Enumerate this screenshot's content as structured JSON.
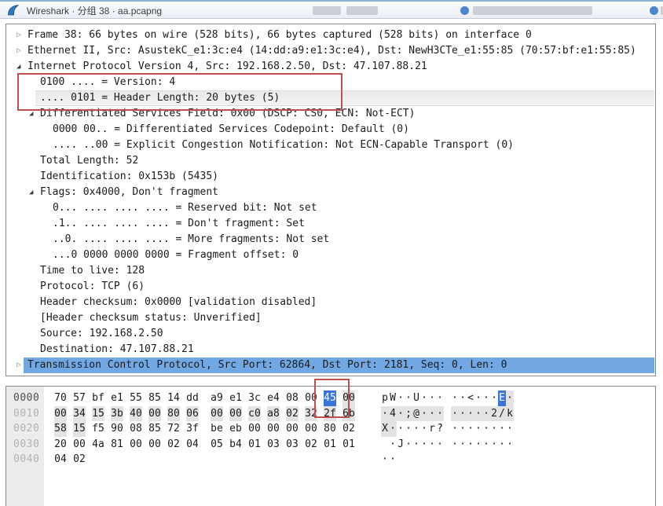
{
  "window": {
    "title": "Wireshark · 分组 38 · aa.pcapng",
    "app_icon": "wireshark-fin-icon"
  },
  "colors": {
    "row_selection_blue": "#71a7e3",
    "hex_byte_selection_blue": "#3b74d9",
    "field_highlight_gray": "#ececec",
    "annotation_red": "#c0504d"
  },
  "packet_tree": {
    "rows": [
      {
        "label": "Frame 38: 66 bytes on wire (528 bits), 66 bytes captured (528 bits) on interface 0",
        "level": 0,
        "arrow": "collapsed",
        "highlight": "none"
      },
      {
        "label": "Ethernet II, Src: AsustekC_e1:3c:e4 (14:dd:a9:e1:3c:e4), Dst: NewH3CTe_e1:55:85 (70:57:bf:e1:55:85)",
        "level": 0,
        "arrow": "collapsed",
        "highlight": "none"
      },
      {
        "label": "Internet Protocol Version 4, Src: 192.168.2.50, Dst: 47.107.88.21",
        "level": 0,
        "arrow": "expanded",
        "highlight": "none"
      },
      {
        "label": "0100 .... = Version: 4",
        "level": 1,
        "arrow": "none",
        "highlight": "none"
      },
      {
        "label": ".... 0101 = Header Length: 20 bytes (5)",
        "level": 1,
        "arrow": "none",
        "highlight": "gray"
      },
      {
        "label": "Differentiated Services Field: 0x00 (DSCP: CS0, ECN: Not-ECT)",
        "level": 1,
        "arrow": "expanded",
        "highlight": "none"
      },
      {
        "label": "0000 00.. = Differentiated Services Codepoint: Default (0)",
        "level": 2,
        "arrow": "none",
        "highlight": "none"
      },
      {
        "label": ".... ..00 = Explicit Congestion Notification: Not ECN-Capable Transport (0)",
        "level": 2,
        "arrow": "none",
        "highlight": "none"
      },
      {
        "label": "Total Length: 52",
        "level": 1,
        "arrow": "none",
        "highlight": "none"
      },
      {
        "label": "Identification: 0x153b (5435)",
        "level": 1,
        "arrow": "none",
        "highlight": "none"
      },
      {
        "label": "Flags: 0x4000, Don't fragment",
        "level": 1,
        "arrow": "expanded",
        "highlight": "none"
      },
      {
        "label": "0... .... .... .... = Reserved bit: Not set",
        "level": 2,
        "arrow": "none",
        "highlight": "none"
      },
      {
        "label": ".1.. .... .... .... = Don't fragment: Set",
        "level": 2,
        "arrow": "none",
        "highlight": "none"
      },
      {
        "label": "..0. .... .... .... = More fragments: Not set",
        "level": 2,
        "arrow": "none",
        "highlight": "none"
      },
      {
        "label": "...0 0000 0000 0000 = Fragment offset: 0",
        "level": 2,
        "arrow": "none",
        "highlight": "none"
      },
      {
        "label": "Time to live: 128",
        "level": 1,
        "arrow": "none",
        "highlight": "none"
      },
      {
        "label": "Protocol: TCP (6)",
        "level": 1,
        "arrow": "none",
        "highlight": "none"
      },
      {
        "label": "Header checksum: 0x0000 [validation disabled]",
        "level": 1,
        "arrow": "none",
        "highlight": "none"
      },
      {
        "label": "[Header checksum status: Unverified]",
        "level": 1,
        "arrow": "none",
        "highlight": "none"
      },
      {
        "label": "Source: 192.168.2.50",
        "level": 1,
        "arrow": "none",
        "highlight": "none"
      },
      {
        "label": "Destination: 47.107.88.21",
        "level": 1,
        "arrow": "none",
        "highlight": "none"
      },
      {
        "label": "Transmission Control Protocol, Src Port: 62864, Dst Port: 2181, Seq: 0, Len: 0",
        "level": 0,
        "arrow": "collapsed",
        "highlight": "blue"
      }
    ]
  },
  "hex_view": {
    "rows": [
      {
        "offset": "0000",
        "offset_style": "active",
        "bytes": [
          "70",
          "57",
          "bf",
          "e1",
          "55",
          "85",
          "14",
          "dd",
          "a9",
          "e1",
          "3c",
          "e4",
          "08",
          "00",
          "45",
          "00"
        ],
        "ascii": [
          "p",
          "W",
          "·",
          "·",
          "U",
          "·",
          "·",
          "·",
          "·",
          "·",
          "<",
          "·",
          "·",
          "·",
          "E",
          "·"
        ],
        "byte_styles": [
          "n",
          "n",
          "n",
          "n",
          "n",
          "n",
          "n",
          "n",
          "n",
          "n",
          "n",
          "n",
          "n",
          "n",
          "sel",
          "hdr"
        ]
      },
      {
        "offset": "0010",
        "offset_style": "normal",
        "bytes": [
          "00",
          "34",
          "15",
          "3b",
          "40",
          "00",
          "80",
          "06",
          "00",
          "00",
          "c0",
          "a8",
          "02",
          "32",
          "2f",
          "6b"
        ],
        "ascii": [
          "·",
          "4",
          "·",
          ";",
          "@",
          "·",
          "·",
          "·",
          "·",
          "·",
          "·",
          "·",
          "·",
          "2",
          "/",
          "k"
        ],
        "byte_styles": [
          "hdr",
          "hdr",
          "hdr",
          "hdr",
          "hdr",
          "hdr",
          "hdr",
          "hdr",
          "hdr",
          "hdr",
          "hdr",
          "hdr",
          "hdr",
          "hdr",
          "hdr",
          "hdr"
        ]
      },
      {
        "offset": "0020",
        "offset_style": "normal",
        "bytes": [
          "58",
          "15",
          "f5",
          "90",
          "08",
          "85",
          "72",
          "3f",
          "be",
          "eb",
          "00",
          "00",
          "00",
          "00",
          "80",
          "02"
        ],
        "ascii": [
          "X",
          "·",
          "·",
          "·",
          "·",
          "·",
          "r",
          "?",
          "·",
          "·",
          "·",
          "·",
          "·",
          "·",
          "·",
          "·"
        ],
        "byte_styles": [
          "hdr",
          "hdr",
          "n",
          "n",
          "n",
          "n",
          "n",
          "n",
          "n",
          "n",
          "n",
          "n",
          "n",
          "n",
          "n",
          "n"
        ]
      },
      {
        "offset": "0030",
        "offset_style": "normal",
        "bytes": [
          "20",
          "00",
          "4a",
          "81",
          "00",
          "00",
          "02",
          "04",
          "05",
          "b4",
          "01",
          "03",
          "03",
          "02",
          "01",
          "01"
        ],
        "ascii": [
          " ",
          "·",
          "J",
          "·",
          "·",
          "·",
          "·",
          "·",
          "·",
          "·",
          "·",
          "·",
          "·",
          "·",
          "·",
          "·"
        ],
        "byte_styles": [
          "n",
          "n",
          "n",
          "n",
          "n",
          "n",
          "n",
          "n",
          "n",
          "n",
          "n",
          "n",
          "n",
          "n",
          "n",
          "n"
        ]
      },
      {
        "offset": "0040",
        "offset_style": "normal",
        "bytes": [
          "04",
          "02"
        ],
        "ascii": [
          "·",
          "·"
        ],
        "byte_styles": [
          "n",
          "n"
        ]
      }
    ]
  }
}
